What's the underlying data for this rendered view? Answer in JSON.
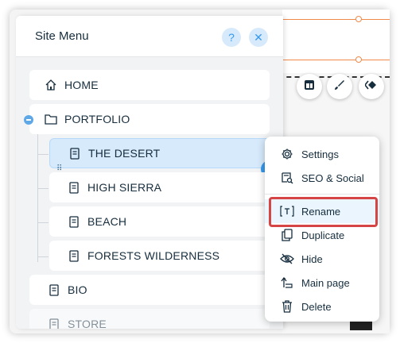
{
  "site_menu": {
    "title": "Site Menu",
    "help_label": "?",
    "close_label": "✕",
    "pages": [
      {
        "label": "HOME",
        "icon": "home-icon"
      },
      {
        "label": "PORTFOLIO",
        "icon": "folder-icon"
      },
      {
        "label": "THE DESERT",
        "icon": "page-icon",
        "selected": true
      },
      {
        "label": "HIGH SIERRA",
        "icon": "page-icon"
      },
      {
        "label": "BEACH",
        "icon": "page-icon"
      },
      {
        "label": "FORESTS WILDERNESS",
        "icon": "page-icon"
      },
      {
        "label": "BIO",
        "icon": "page-icon"
      },
      {
        "label": "STORE",
        "icon": "page-icon"
      }
    ],
    "more_label": "···"
  },
  "context_menu": {
    "items": [
      {
        "label": "Settings",
        "icon": "gear-icon"
      },
      {
        "label": "SEO & Social",
        "icon": "seo-icon"
      },
      {
        "label": "Rename",
        "icon": "rename-icon",
        "highlighted": true
      },
      {
        "label": "Duplicate",
        "icon": "duplicate-icon"
      },
      {
        "label": "Hide",
        "icon": "hide-icon"
      },
      {
        "label": "Main page",
        "icon": "main-page-icon"
      },
      {
        "label": "Delete",
        "icon": "trash-icon"
      }
    ]
  },
  "colors": {
    "accent": "#3899ec",
    "selected_bg": "#d6eafc",
    "highlight_border": "#d64545",
    "guide_line": "#f08a4b"
  }
}
